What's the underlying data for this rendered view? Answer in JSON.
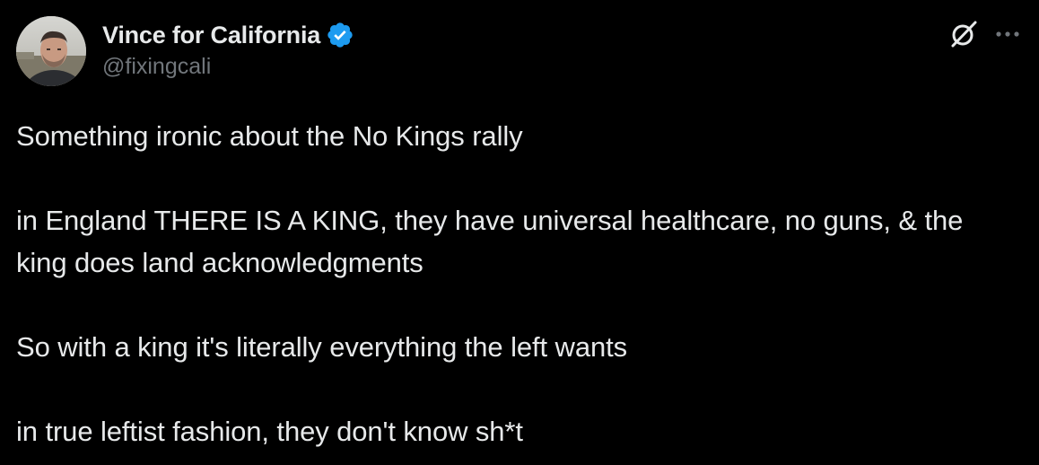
{
  "author": {
    "display_name": "Vince for California",
    "handle": "@fixingcali",
    "verified_icon": "verified-badge-icon",
    "verified_color": "#1d9bf0"
  },
  "header_actions": {
    "grok_icon": "grok-icon",
    "more_icon": "more-options-icon"
  },
  "tweet": {
    "paragraphs": [
      "Something ironic about the No Kings rally",
      "in England THERE IS A KING, they have universal healthcare, no guns, & the king does land acknowledgments",
      "So with a king it's literally everything the left wants",
      "in true leftist fashion, they don't know sh*t"
    ]
  },
  "colors": {
    "background": "#000000",
    "text_primary": "#e7e9ea",
    "text_secondary": "#71767b"
  }
}
